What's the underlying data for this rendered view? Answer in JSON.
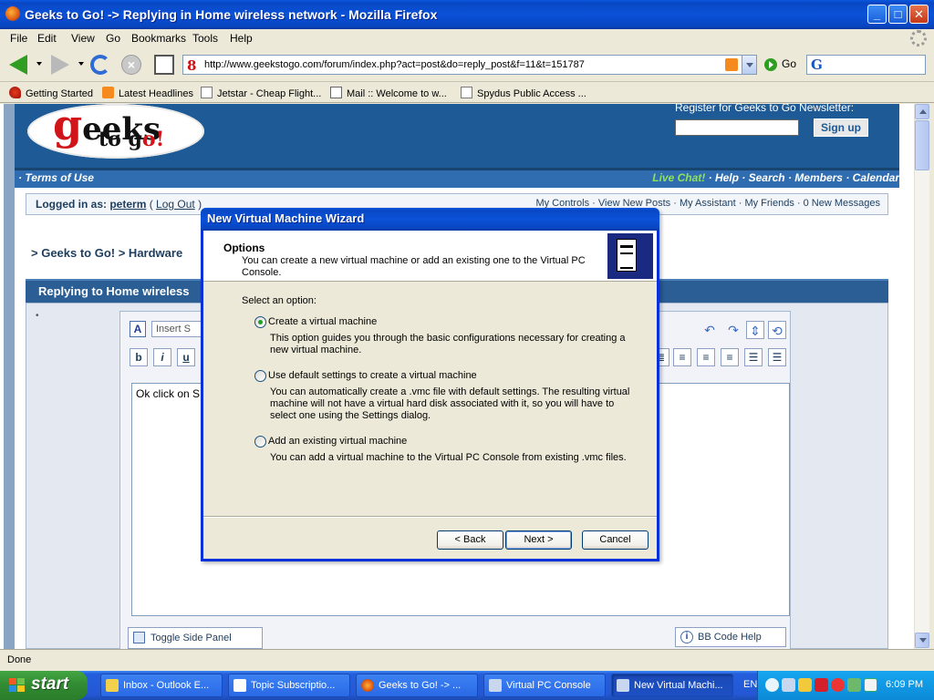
{
  "window": {
    "title": "Geeks to Go! -> Replying in Home wireless network - Mozilla Firefox",
    "controls": {
      "minimize": "_",
      "maximize": "□",
      "close": "✕"
    }
  },
  "menu": [
    "File",
    "Edit",
    "View",
    "Go",
    "Bookmarks",
    "Tools",
    "Help"
  ],
  "nav": {
    "url": "http://www.geekstogo.com/forum/index.php?act=post&do=reply_post&f=11&t=151787",
    "go_label": "Go",
    "search_value": ""
  },
  "bookmarks": [
    {
      "label": "Getting Started",
      "icon": "red-hat-icon"
    },
    {
      "label": "Latest Headlines",
      "icon": "rss-icon"
    },
    {
      "label": "Jetstar - Cheap Flight...",
      "icon": "page-icon"
    },
    {
      "label": "Mail :: Welcome to w...",
      "icon": "mail-icon"
    },
    {
      "label": "Spydus Public Access ...",
      "icon": "page-icon"
    }
  ],
  "site": {
    "logo_g": "g",
    "logo_eeks": "eeks",
    "logo_to": "to g",
    "logo_o": "o!",
    "newsletter_label": "Register for Geeks to Go Newsletter:",
    "signup_label": "Sign up",
    "nav_left": "· Terms of Use",
    "nav_live": "Live Chat!",
    "nav_right": "· Help · Search · Members · Calendar",
    "logged_in_prefix": "Logged in as:",
    "username": "peterm",
    "logout_open": "(",
    "logout": "Log Out",
    "logout_close": ")",
    "user_links": "My Controls · View New Posts · My Assistant · My Friends · 0 New Messages",
    "breadcrumb": "> Geeks to Go! > Hardware",
    "reply_title": "Replying to Home wireless",
    "insert_placeholder": "Insert S",
    "bold": "b",
    "italic": "i",
    "underline": "u",
    "editor_text": "Ok click on S",
    "toggle_panel": "Toggle Side Panel",
    "bbcode_help": "BB Code Help"
  },
  "status": "Done",
  "wizard": {
    "title": "New Virtual Machine Wizard",
    "heading": "Options",
    "description": "You can create a new virtual machine or add an existing one to the Virtual PC Console.",
    "select_label": "Select an option:",
    "options": [
      {
        "label": "Create a virtual machine",
        "desc": "This option guides you through the basic configurations necessary for creating a new virtual machine.",
        "selected": true
      },
      {
        "label": "Use default settings to create a virtual machine",
        "desc": "You can automatically create a .vmc file with default settings. The resulting virtual machine will not have a virtual hard disk associated with it, so you will have to select one using the Settings dialog.",
        "selected": false
      },
      {
        "label": "Add an existing virtual machine",
        "desc": "You can add a virtual machine to the Virtual PC Console from existing .vmc files.",
        "selected": false
      }
    ],
    "back": "< Back",
    "next": "Next >",
    "cancel": "Cancel"
  },
  "taskbar": {
    "start": "start",
    "tasks": [
      {
        "label": "Inbox - Outlook E...",
        "icon": "outlook-icon"
      },
      {
        "label": "Topic Subscriptio...",
        "icon": "mail-icon"
      },
      {
        "label": "Geeks to Go! -> ...",
        "icon": "firefox-icon"
      },
      {
        "label": "Virtual PC Console",
        "icon": "virtual-pc-icon"
      },
      {
        "label": "New Virtual Machi...",
        "icon": "virtual-pc-icon",
        "active": true
      }
    ],
    "language": "EN",
    "clock": "6:09 PM"
  }
}
